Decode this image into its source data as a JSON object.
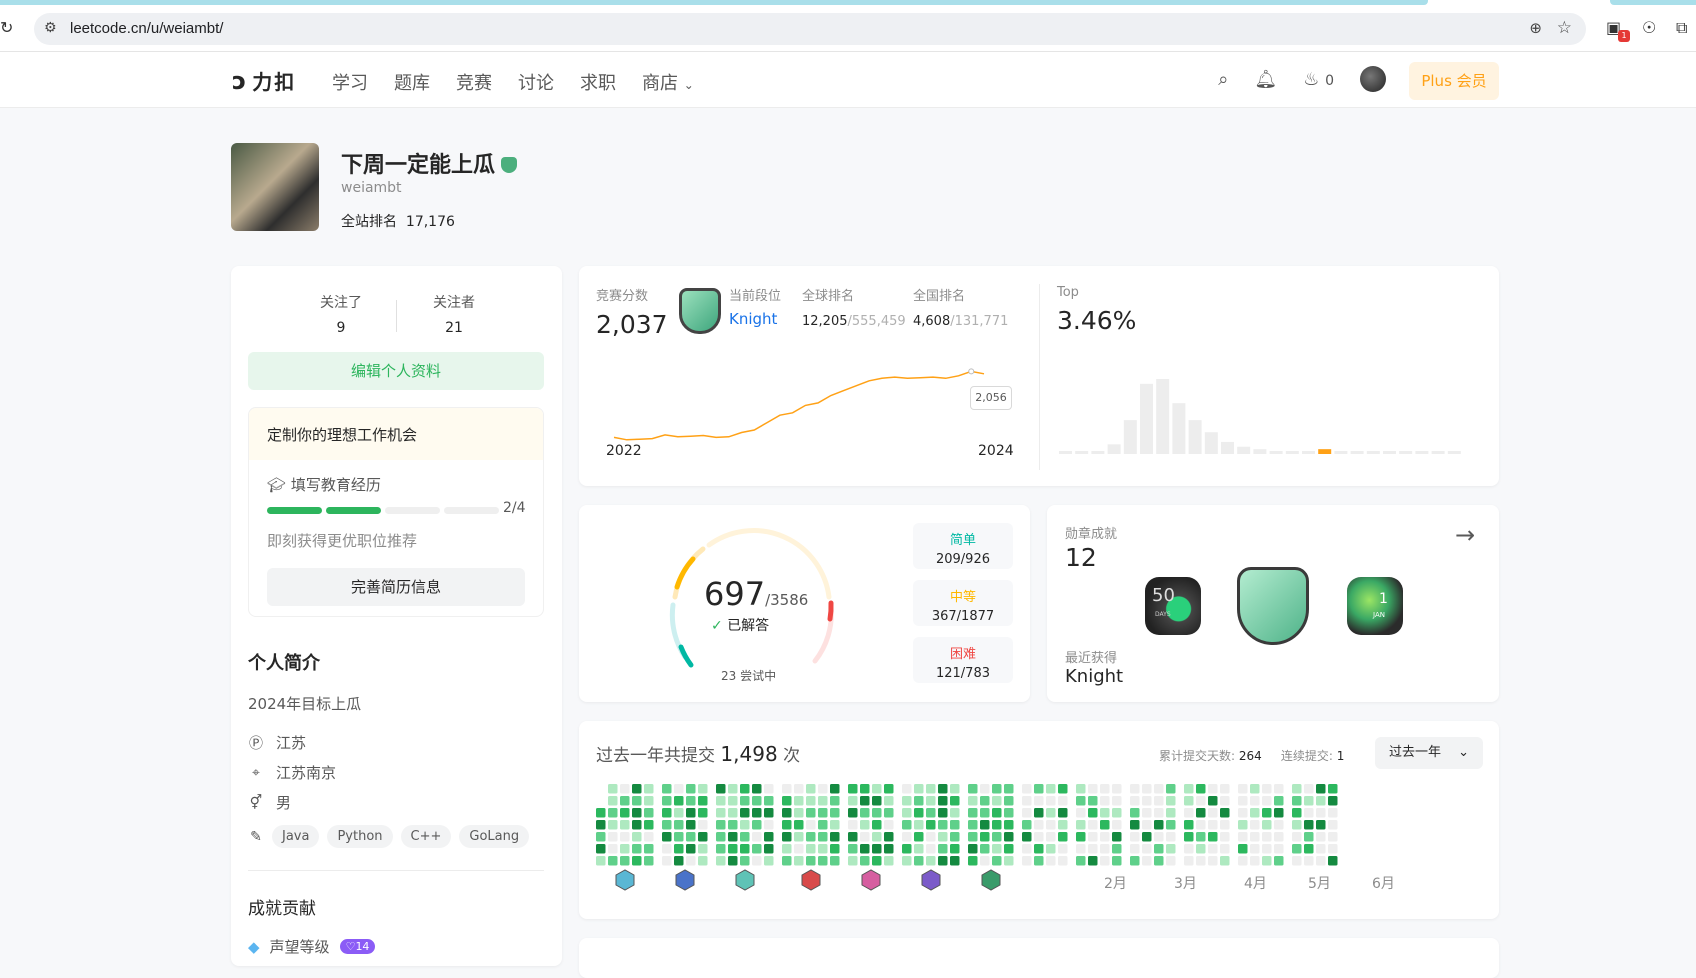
{
  "browser": {
    "url": "leetcode.cn/u/weiambt/",
    "ext_badge": "1"
  },
  "nav": {
    "logo_text": "力扣",
    "items": [
      "学习",
      "题库",
      "竞赛",
      "讨论",
      "求职",
      "商店"
    ],
    "store_label": "商店",
    "streak_count": "0",
    "plus_label": "Plus 会员"
  },
  "profile": {
    "name": "下周一定能上瓜",
    "username": "weiambt",
    "rank_label": "全站排名",
    "rank_value": "17,176"
  },
  "sidebar": {
    "following_label": "关注了",
    "following_count": "9",
    "followers_label": "关注者",
    "followers_count": "21",
    "edit_button": "编辑个人资料",
    "job_title": "定制你的理想工作机会",
    "edu_label": "填写教育经历",
    "edu_progress": "2/4",
    "edu_progress_fraction": 0.5,
    "job_hint": "即刻获得更优职位推荐",
    "job_button": "完善简历信息",
    "bio_title": "个人简介",
    "bio": "2024年目标上瓜",
    "ip_location": "江苏",
    "location": "江苏南京",
    "gender": "男",
    "skills": [
      "Java",
      "Python",
      "C++",
      "GoLang"
    ],
    "achievements_title": "成就贡献",
    "reputation_label": "声望等级",
    "reputation_level": "14"
  },
  "contest": {
    "score_label": "竞赛分数",
    "score": "2,037",
    "level_label": "当前段位",
    "level": "Knight",
    "global_rank_label": "全球排名",
    "global_rank": "12,205",
    "global_total": "/555,459",
    "national_rank_label": "全国排名",
    "national_rank": "4,608",
    "national_total": "/131,771",
    "top_label": "Top",
    "top_value": "3.46%",
    "tooltip": "2,056",
    "year_start": "2022",
    "year_end": "2024"
  },
  "chart_data": {
    "type": "line",
    "x_range": [
      "2022",
      "2024"
    ],
    "series": [
      {
        "values": [
          1520,
          1500,
          1505,
          1510,
          1540,
          1525,
          1530,
          1535,
          1520,
          1525,
          1560,
          1580,
          1640,
          1700,
          1720,
          1780,
          1800,
          1860,
          1900,
          1940,
          1980,
          2000,
          2010,
          2000,
          2005,
          2010,
          2000,
          2020,
          2056,
          2037
        ]
      }
    ]
  },
  "distribution": {
    "highlight_index": 16,
    "bars": [
      2,
      2,
      2,
      8,
      28,
      58,
      62,
      42,
      28,
      18,
      10,
      6,
      4,
      2,
      2,
      2,
      4,
      2,
      2,
      2,
      2,
      2,
      2,
      2,
      2
    ]
  },
  "solved": {
    "count": "697",
    "total": "/3586",
    "label": "已解答",
    "attempting": "23 尝试中",
    "easy_label": "简单",
    "easy": "209/926",
    "medium_label": "中等",
    "medium": "367/1877",
    "hard_label": "困难",
    "hard": "121/783"
  },
  "medals": {
    "label": "勋章成就",
    "count": "12",
    "recent_label": "最近获得",
    "recent": "Knight",
    "badge_texts": [
      "50",
      "DAYS",
      "1",
      "JAN"
    ]
  },
  "submissions": {
    "title_prefix": "过去一年共提交",
    "total": "1,498",
    "title_suffix": "次",
    "days_label": "累计提交天数:",
    "days": "264",
    "streak_label": "连续提交:",
    "streak": "1",
    "range": "过去一年",
    "months": [
      "2月",
      "3月",
      "4月",
      "5月",
      "6月"
    ]
  },
  "colors": {
    "accent": "#ffa116",
    "green": "#2db55d",
    "easy": "#00b8a3",
    "medium": "#ffb800",
    "hard": "#ef4743",
    "knight": "#1a73e8"
  }
}
